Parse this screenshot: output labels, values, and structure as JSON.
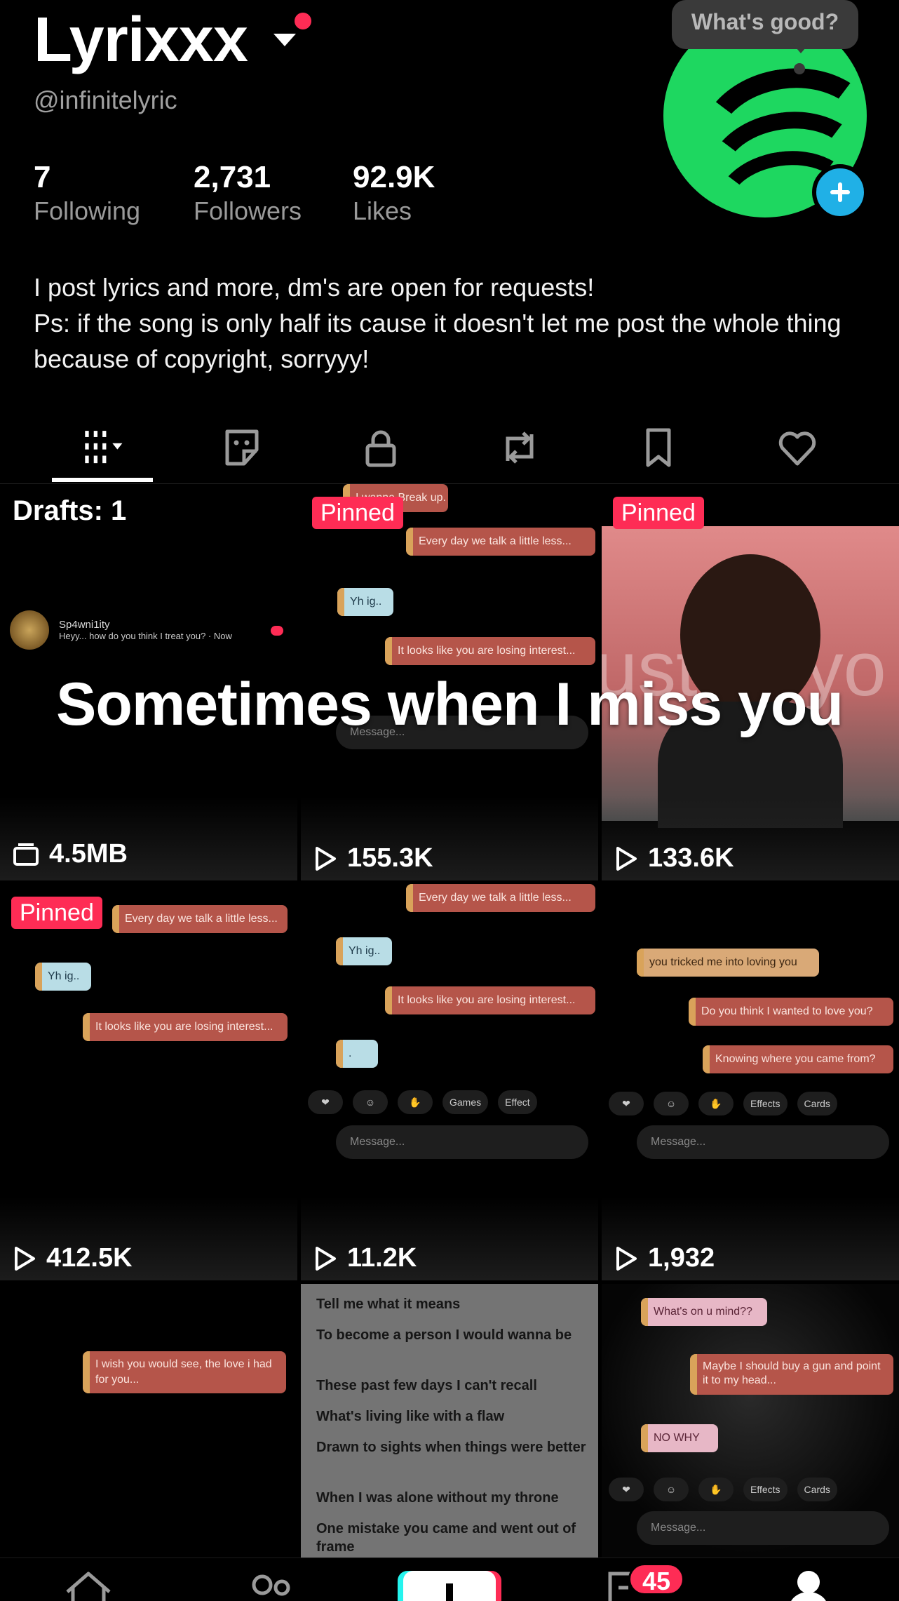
{
  "profile": {
    "name": "Lyrixxx",
    "handle": "@infinitelyric",
    "status_bubble": "What's good?",
    "stats": {
      "following_count": "7",
      "following_label": "Following",
      "followers_count": "2,731",
      "followers_label": "Followers",
      "likes_count": "92.9K",
      "likes_label": "Likes"
    },
    "bio_line1": "I post lyrics and more, dm's are open for requests!",
    "bio_line2": "Ps: if the song is only half its cause it doesn't let me post the whole thing because of copyright, sorryyy!"
  },
  "tabs": [
    {
      "name": "videos-grid",
      "icon": "grid-icon"
    },
    {
      "name": "stickers",
      "icon": "sticker-icon"
    },
    {
      "name": "private",
      "icon": "lock-icon"
    },
    {
      "name": "reposts",
      "icon": "repost-icon"
    },
    {
      "name": "saved",
      "icon": "bookmark-icon"
    },
    {
      "name": "liked",
      "icon": "heart-icon"
    }
  ],
  "caption_overlay": "Sometimes when I miss you",
  "videos": {
    "drafts_label": "Drafts: 1",
    "drafts_size": "4.5MB",
    "drafts_chat_name": "Sp4wni1ity",
    "drafts_chat_text": "Heyy... how do you think I treat you? · Now",
    "pinned_label": "Pinned",
    "v2_views": "155.3K",
    "v3_views": "133.6K",
    "v4_views": "412.5K",
    "v5_views": "11.2K",
    "v6_views": "1,932",
    "v2_msgs": [
      "I wanna Break up.",
      "Every day we talk a little less...",
      "Yh ig..",
      "It looks like you are losing interest..."
    ],
    "v2_compose": "Message...",
    "v3_bgtext": "usted yo",
    "v4_msgs": [
      "Every day we talk a little less...",
      "Yh ig..",
      "It looks like you are losing interest..."
    ],
    "v5_msgs": [
      "Every day we talk a little less...",
      "Yh ig..",
      "It looks like you are losing interest...",
      "."
    ],
    "v5_reacts": [
      "Games",
      "Effect"
    ],
    "v5_compose": "Message...",
    "v6_msgs": [
      "you tricked me into loving you",
      "Do you think I wanted to love you?",
      "Knowing where you came from?"
    ],
    "v6_reacts": [
      "Effects",
      "Cards"
    ],
    "v6_compose": "Message...",
    "v7_msg": "I wish you would see, the love i had for you...",
    "v8_lyrics": [
      "Tell me what it means",
      "To become a person I would wanna be",
      "These past few days I can't recall",
      "What's living like with a flaw",
      "Drawn to sights when things were better",
      "When I was alone without my throne",
      "One mistake you came and went out of frame"
    ],
    "v9_msgs": [
      "What's on u mind??",
      "Maybe I should buy a gun and point it to my head...",
      "NO WHY"
    ],
    "v9_reacts": [
      "Effects",
      "Cards"
    ],
    "v9_compose": "Message..."
  },
  "nav": {
    "inbox_badge": "45"
  },
  "colors": {
    "accent": "#fe2c55",
    "spotify_green": "#1ed760",
    "add_blue": "#20b0e6"
  }
}
